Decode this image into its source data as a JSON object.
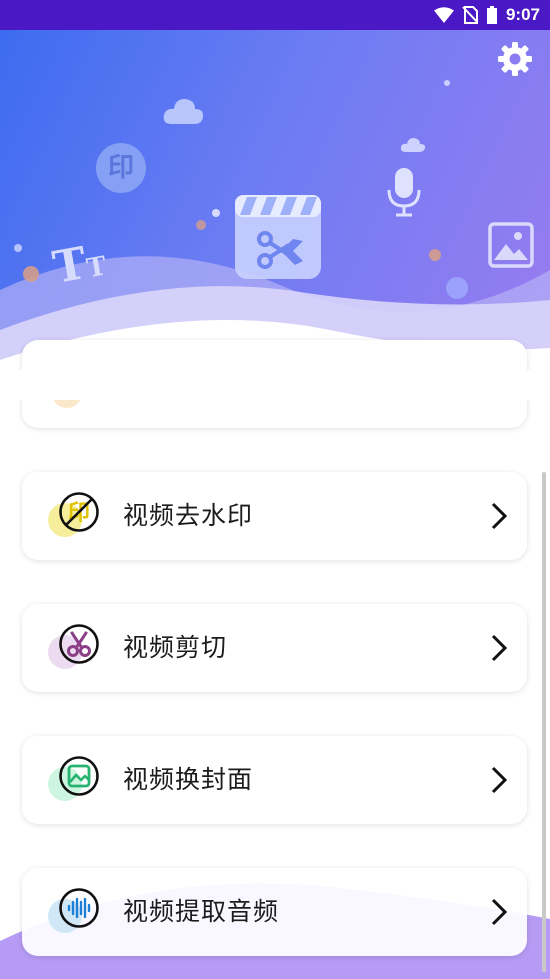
{
  "status_bar": {
    "time": "9:07",
    "icons": [
      "wifi-icon",
      "no-sim-icon",
      "battery-icon"
    ]
  },
  "header": {
    "settings_icon": "gear-icon",
    "gradient": [
      "#3d6cf0",
      "#9a7cf0"
    ],
    "decorations": [
      "cloud-icon",
      "stamp-icon",
      "text-size-icon",
      "clapperboard-scissors-icon",
      "microphone-icon",
      "image-icon"
    ],
    "stamp_text": "印",
    "text_size_glyphs": [
      "T",
      "T"
    ]
  },
  "menu": {
    "items": [
      {
        "label": "视频去水印",
        "icon": "no-watermark-icon",
        "icon_text": "印",
        "accent": "#f6e77a"
      },
      {
        "label": "视频剪切",
        "icon": "scissors-icon",
        "accent": "#e8d6ef"
      },
      {
        "label": "视频换封面",
        "icon": "cover-image-icon",
        "accent": "#c8f3dc"
      },
      {
        "label": "视频提取音频",
        "icon": "audio-wave-icon",
        "accent": "#c9e5f6"
      }
    ]
  },
  "colors": {
    "status_bar": "#4a18c4",
    "watermark_icon": "#e0c300",
    "scissors_icon": "#8a3f86",
    "cover_icon": "#26b36f",
    "audio_icon": "#1e7fd6",
    "bottom_wave": "#a98af2"
  }
}
